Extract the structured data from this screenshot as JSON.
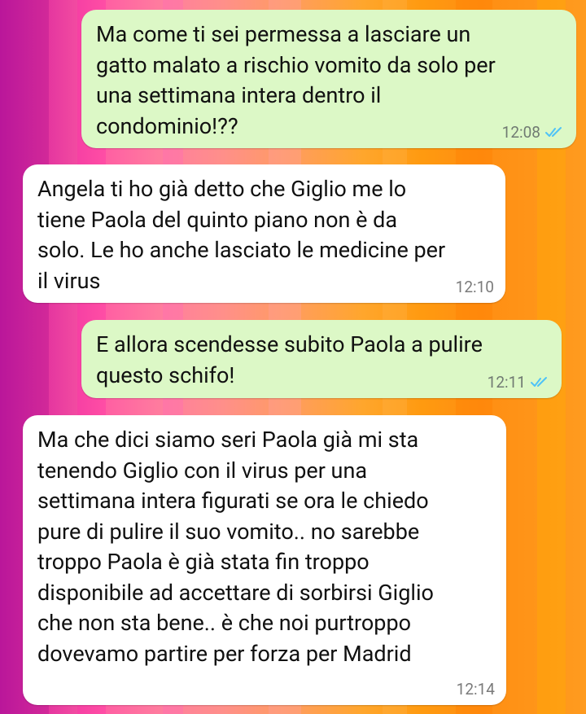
{
  "colors": {
    "outgoing_bubble": "#dcf8c6",
    "incoming_bubble": "#ffffff",
    "read_ticks": "#4fc3f7",
    "timestamp": "#707a72"
  },
  "messages": [
    {
      "direction": "out",
      "text": "Ma come ti sei permessa a lasciare un\ngatto malato a rischio vomito da solo per\nuna settimana intera dentro il\ncondominio!??",
      "time": "12:08",
      "status_icon": "double-check-read-icon"
    },
    {
      "direction": "in",
      "text": "Angela ti ho già detto che Giglio me lo\ntiene Paola del quinto piano non è da\nsolo. Le ho anche lasciato le medicine per\nil virus",
      "time": "12:10"
    },
    {
      "direction": "out",
      "text": "E allora scendesse subito Paola a pulire\nquesto schifo!",
      "time": "12:11",
      "status_icon": "double-check-read-icon"
    },
    {
      "direction": "in",
      "text": "Ma che dici siamo seri Paola già mi sta\ntenendo Giglio con il virus per una\nsettimana intera figurati se ora le chiedo\npure di pulire il suo vomito.. no sarebbe\ntroppo Paola è già stata fin troppo\ndisponibile ad accettare di sorbirsi Giglio\nche non sta bene.. è che noi purtroppo\ndovevamo partire per forza per Madrid",
      "time": "12:14"
    }
  ]
}
